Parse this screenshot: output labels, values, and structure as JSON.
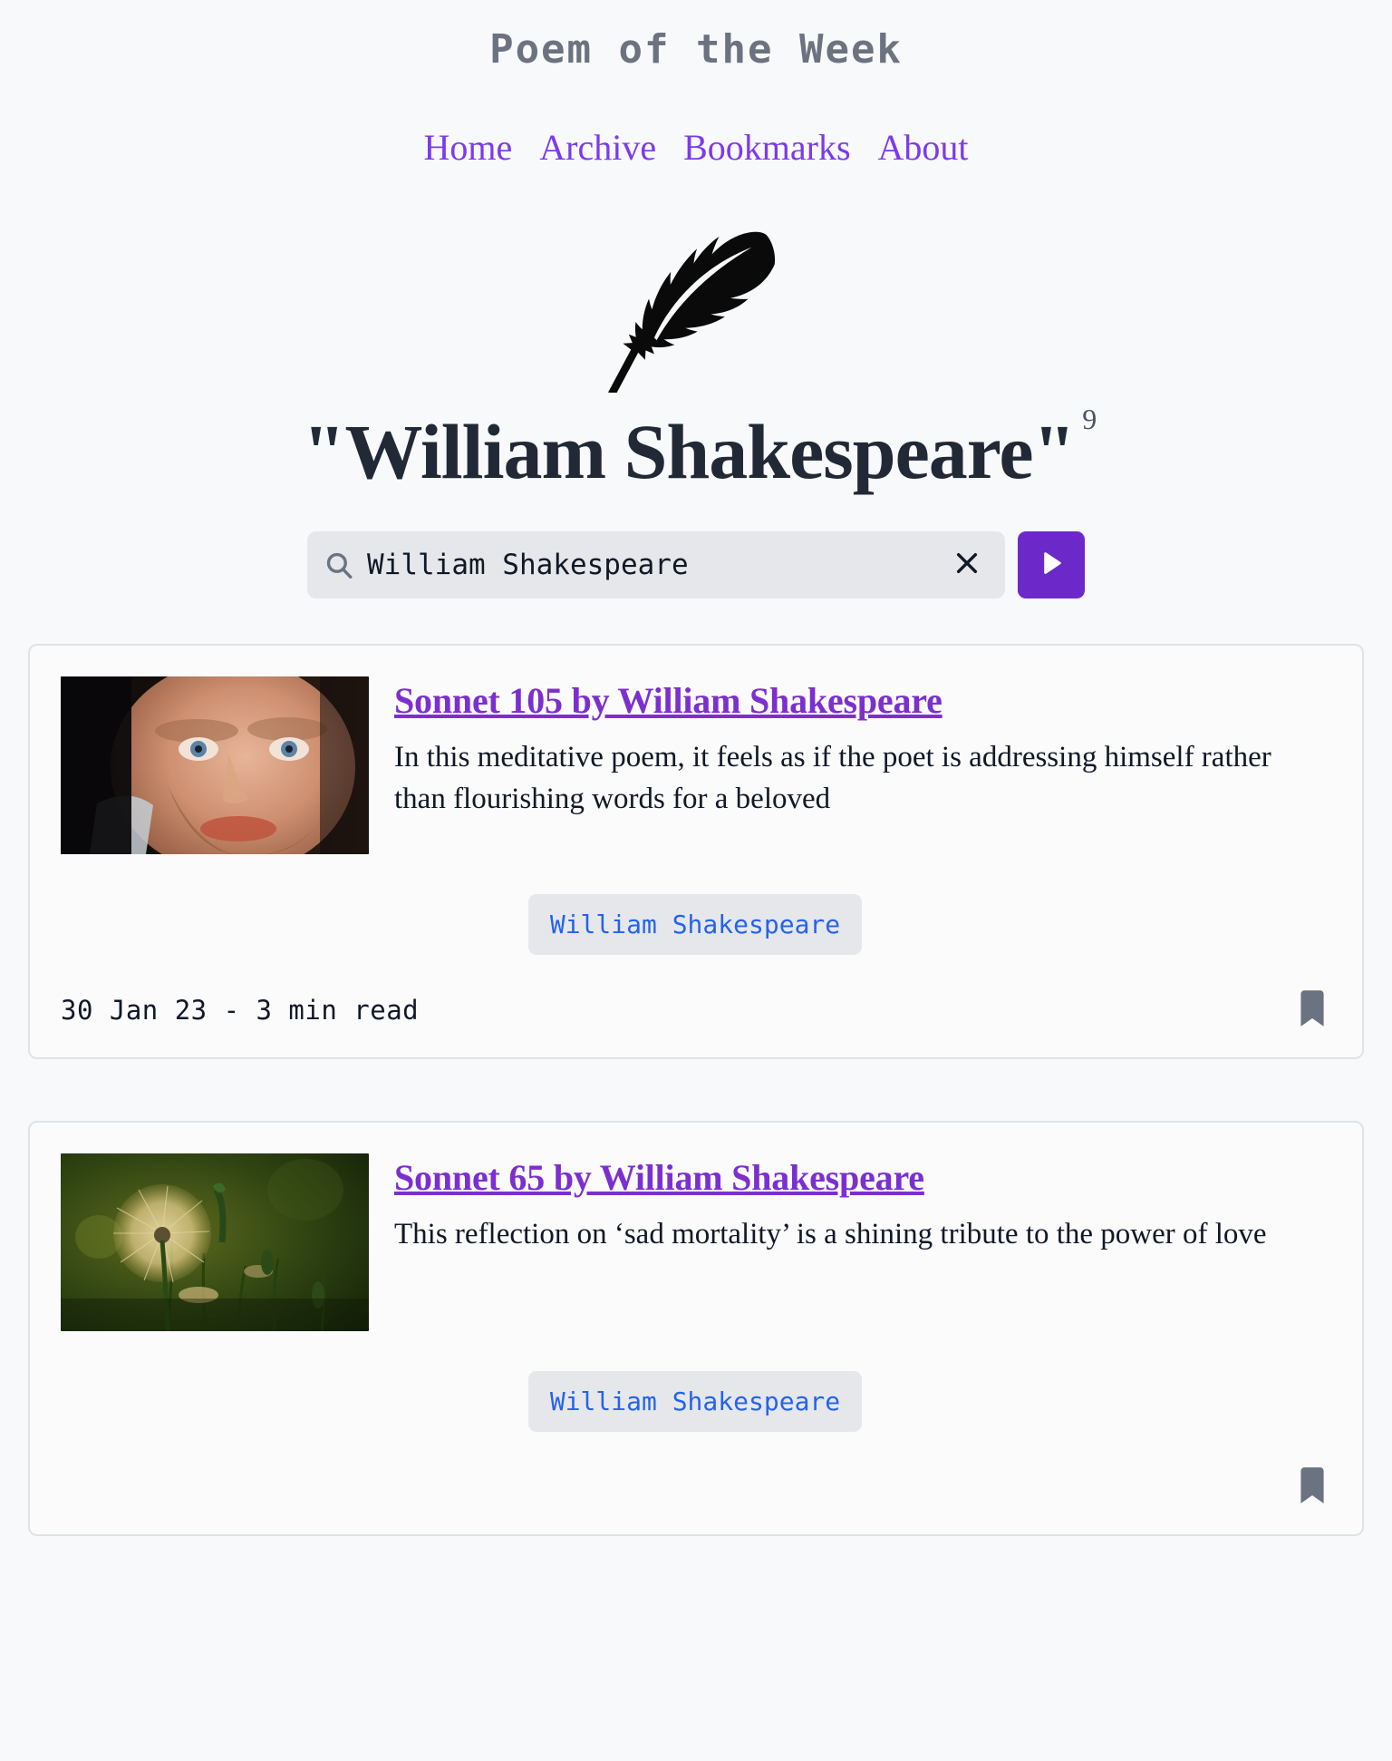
{
  "header": {
    "site_title": "Poem of the Week",
    "nav": [
      {
        "label": "Home"
      },
      {
        "label": "Archive"
      },
      {
        "label": "Bookmarks"
      },
      {
        "label": "About"
      }
    ],
    "logo_icon": "feather-quill-icon"
  },
  "results_heading": {
    "query_quoted": "\"William Shakespeare\"",
    "result_count": "9"
  },
  "search": {
    "value": "William Shakespeare",
    "placeholder": "Search poems...",
    "search_icon": "search-icon",
    "clear_icon": "close-icon",
    "submit_icon": "play-icon"
  },
  "colors": {
    "background": "#f8f9fa",
    "accent_purple": "#6d28c9",
    "link_purple": "#7c3aed",
    "title_purple": "#7c2fce",
    "heading_navy": "#212936",
    "site_title_grey": "#6b7280",
    "chip_background": "#e5e7eb",
    "chip_text_blue": "#2563eb",
    "card_border": "#dfe3e8",
    "bookmark_grey": "#6b7280"
  },
  "results": [
    {
      "title": "Sonnet 105 by William Shakespeare",
      "description": "In this meditative poem, it feels as if the poet is addressing himself rather than flourishing words for a beloved",
      "tag": "William Shakespeare",
      "meta": "30 Jan 23 - 3 min read",
      "thumbnail": "shakespeare-portrait-thumbnail",
      "bookmark_icon": "bookmark-icon"
    },
    {
      "title": "Sonnet 65 by William Shakespeare",
      "description": "This reflection on ‘sad mortality’ is a shining tribute to the power of love",
      "tag": "William Shakespeare",
      "meta": "",
      "thumbnail": "dandelion-thumbnail",
      "bookmark_icon": "bookmark-icon"
    }
  ]
}
